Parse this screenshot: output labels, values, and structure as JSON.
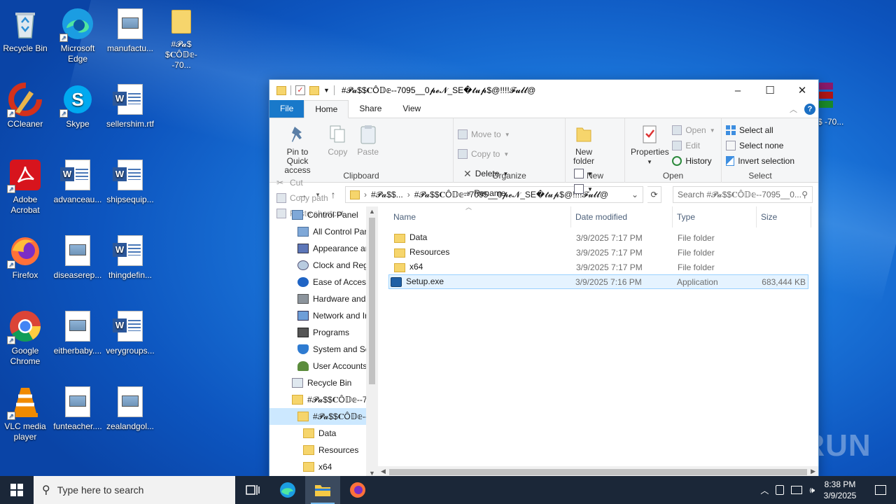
{
  "desktop": {
    "icons": [
      {
        "label": "Recycle Bin"
      },
      {
        "label": "Microsoft Edge"
      },
      {
        "label": "manufactu..."
      },
      {
        "label": "#𝓟𝓪$ $𝐂Ô𝔻𝕖--70..."
      },
      {
        "label": "CCleaner"
      },
      {
        "label": "Skype"
      },
      {
        "label": "sellershim.rtf"
      },
      {
        "label": "Adobe Acrobat"
      },
      {
        "label": "advanceau..."
      },
      {
        "label": "shipsequip..."
      },
      {
        "label": "Firefox"
      },
      {
        "label": "diseaserep..."
      },
      {
        "label": "thingdefin..."
      },
      {
        "label": "Google Chrome"
      },
      {
        "label": "eitherbaby...."
      },
      {
        "label": "verygroups..."
      },
      {
        "label": "VLC media player"
      },
      {
        "label": "funteacher...."
      },
      {
        "label": "zealandgol..."
      }
    ],
    "partial_icon_label": "$ -70..."
  },
  "explorer": {
    "title": "#𝓟𝓪$$𝐂Ô𝔻𝕖--7095__0𝓹𝓮𝓝_SE�𝓽𝓾𝓹$@!!!!𝓕𝓾𝓵𝓵@",
    "tabs": {
      "file": "File",
      "home": "Home",
      "share": "Share",
      "view": "View"
    },
    "ribbon": {
      "clipboard": {
        "pin": "Pin to Quick access",
        "copy": "Copy",
        "paste": "Paste",
        "cut": "Cut",
        "copy_path": "Copy path",
        "paste_shortcut": "Paste shortcut",
        "label": "Clipboard"
      },
      "organize": {
        "move_to": "Move to",
        "copy_to": "Copy to",
        "delete": "Delete",
        "rename": "Rename",
        "label": "Organize"
      },
      "new": {
        "new_folder": "New folder",
        "label": "New"
      },
      "open": {
        "properties": "Properties",
        "open": "Open",
        "edit": "Edit",
        "history": "History",
        "label": "Open"
      },
      "select": {
        "select_all": "Select all",
        "select_none": "Select none",
        "invert": "Invert selection",
        "label": "Select"
      }
    },
    "address": {
      "crumb1": "#𝓟𝓪$$...",
      "crumb2": "#𝓟𝓪$$𝐂Ô𝔻𝕖--7095__0𝓹𝓮𝓝_SE�𝓽𝓾𝓹$@!!!!𝓕𝓾𝓵𝓵@",
      "search_placeholder": "Search #𝓟𝓪$$𝐂Ô𝔻𝕖--7095__0..."
    },
    "nav_items": [
      {
        "label": "Control Panel"
      },
      {
        "label": "All Control Par"
      },
      {
        "label": "Appearance an"
      },
      {
        "label": "Clock and Regi"
      },
      {
        "label": "Ease of Access"
      },
      {
        "label": "Hardware and"
      },
      {
        "label": "Network and Ir"
      },
      {
        "label": "Programs"
      },
      {
        "label": "System and Sec"
      },
      {
        "label": "User Accounts"
      },
      {
        "label": "Recycle Bin"
      },
      {
        "label": "#𝓟𝓪$$𝐂Ô𝔻𝕖--7"
      },
      {
        "label": "#𝓟𝓪$$𝐂Ô𝔻𝕖--"
      },
      {
        "label": "Data"
      },
      {
        "label": "Resources"
      },
      {
        "label": "x64"
      }
    ],
    "columns": {
      "name": "Name",
      "date": "Date modified",
      "type": "Type",
      "size": "Size"
    },
    "files": [
      {
        "name": "Data",
        "date": "3/9/2025 7:17 PM",
        "type": "File folder",
        "size": ""
      },
      {
        "name": "Resources",
        "date": "3/9/2025 7:17 PM",
        "type": "File folder",
        "size": ""
      },
      {
        "name": "x64",
        "date": "3/9/2025 7:17 PM",
        "type": "File folder",
        "size": ""
      },
      {
        "name": "Setup.exe",
        "date": "3/9/2025 7:16 PM",
        "type": "Application",
        "size": "683,444 KB"
      }
    ]
  },
  "taskbar": {
    "search_placeholder": "Type here to search",
    "time": "8:38 PM",
    "date": "3/9/2025"
  },
  "watermark": "ANY RUN"
}
